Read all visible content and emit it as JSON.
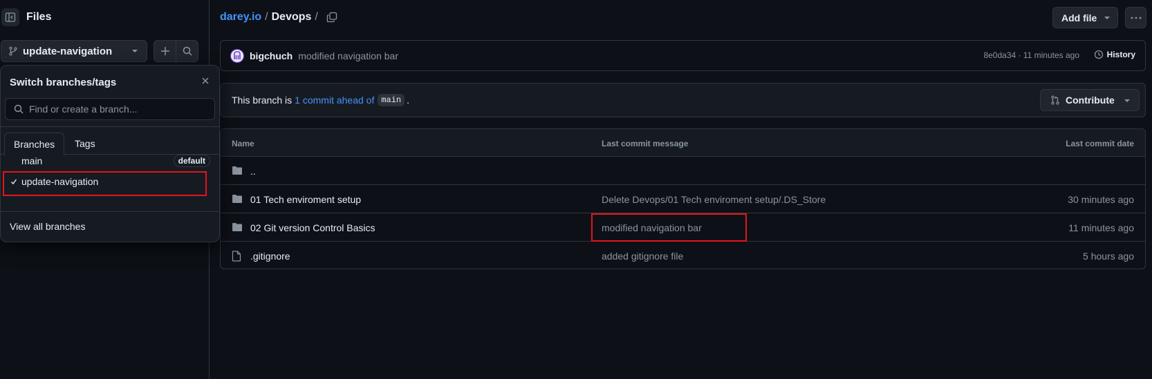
{
  "sidebar": {
    "title": "Files",
    "branch_name": "update-navigation"
  },
  "branch_popover": {
    "title": "Switch branches/tags",
    "search_placeholder": "Find or create a branch...",
    "tabs": [
      "Branches",
      "Tags"
    ],
    "branches": [
      {
        "name": "main",
        "badge": "default",
        "selected": false
      },
      {
        "name": "update-navigation",
        "badge": "",
        "selected": true
      }
    ],
    "view_all": "View all branches"
  },
  "header": {
    "repo": "darey.io",
    "separator": "/",
    "folder": "Devops",
    "trailing_sep": "/",
    "add_file": "Add file"
  },
  "latest_commit": {
    "author": "bigchuch",
    "message": "modified navigation bar",
    "meta": "8e0da34 · 11 minutes ago",
    "history": "History"
  },
  "ahead": {
    "prefix": "This branch is",
    "link": "1 commit ahead of",
    "base": "main",
    "suffix": ".",
    "contribute": "Contribute"
  },
  "table": {
    "headers": [
      "Name",
      "Last commit message",
      "Last commit date"
    ],
    "rows": [
      {
        "name": "..",
        "type": "folder",
        "message": "",
        "date": ""
      },
      {
        "name": "01 Tech enviroment setup",
        "type": "folder",
        "message": "Delete Devops/01 Tech enviroment setup/.DS_Store",
        "date": "30 minutes ago"
      },
      {
        "name": "02 Git version Control Basics",
        "type": "folder",
        "message": "modified navigation bar",
        "date": "11 minutes ago"
      },
      {
        "name": ".gitignore",
        "type": "file",
        "message": "added gitignore file",
        "date": "5 hours ago"
      }
    ]
  },
  "colors": {
    "background": "#0d1117",
    "link": "#4493f8",
    "highlight": "#e5141b"
  }
}
